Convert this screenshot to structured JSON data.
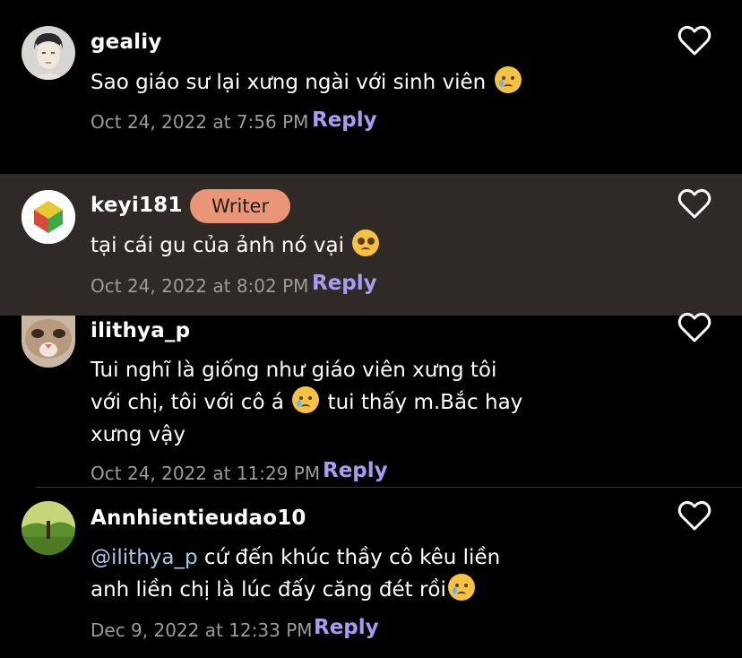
{
  "comments": [
    {
      "username": "gealiy",
      "text": "Sao giáo sư lại xưng ngài với sinh viên",
      "emoji": "smiling-face-with-tear",
      "timestamp": "Oct 24, 2022 at 7:56 PM",
      "reply_label": "Reply"
    },
    {
      "username": "keyi181",
      "badge": "Writer",
      "text": "tại cái gu của ảnh nó vại",
      "emoji": "pleading-face",
      "timestamp": "Oct 24, 2022 at 8:02 PM",
      "reply_label": "Reply"
    },
    {
      "username": "ilithya_p",
      "text_line1": "Tui nghĩ là giống như giáo viên xưng tôi",
      "text_line2_a": "với chị, tôi với cô á",
      "text_line2_b": "tui thấy m.Bắc hay",
      "text_line3": "xưng vậy",
      "emoji": "smiling-face-with-tear",
      "timestamp": "Oct 24, 2022 at 11:29 PM",
      "reply_label": "Reply"
    },
    {
      "username": "Annhientieudao10",
      "mention": "@ilithya_p",
      "text_line1": "cứ đến khúc thầy cô kêu liền",
      "text_line2": "anh liền chị là lúc đấy căng đét rồi",
      "emoji": "smiling-face-with-tear",
      "timestamp": "Dec 9, 2022 at 12:33 PM",
      "reply_label": "Reply"
    }
  ],
  "colors": {
    "background": "#000000",
    "highlight_background": "#2f2a26",
    "badge_background": "#e89677",
    "reply": "#a89cf0",
    "timestamp": "#9b9b9b",
    "mention": "#a8c8e8"
  }
}
